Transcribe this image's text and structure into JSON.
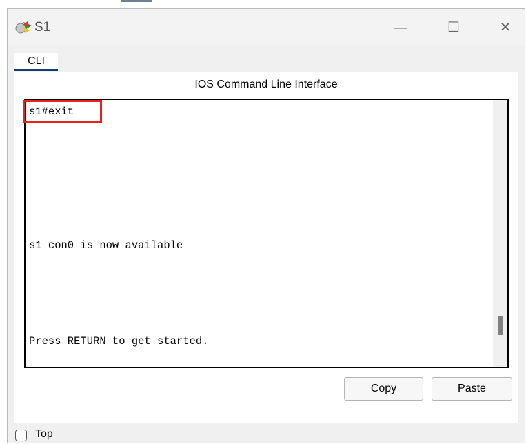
{
  "window": {
    "title": "S1",
    "icon": "packet-tracer-switch-icon",
    "controls": {
      "minimize": "—",
      "maximize": "☐",
      "close": "✕"
    }
  },
  "tabs": [
    {
      "label": "CLI",
      "active": true
    }
  ],
  "panel": {
    "title": "IOS Command Line Interface",
    "terminal": {
      "lines": [
        "s1#exit",
        "s1 con0 is now available",
        "Press RETURN to get started."
      ],
      "highlight_color": "#e8231c"
    }
  },
  "buttons": {
    "copy": "Copy",
    "paste": "Paste"
  },
  "footer": {
    "top_checkbox_label": "Top",
    "top_checked": false
  }
}
